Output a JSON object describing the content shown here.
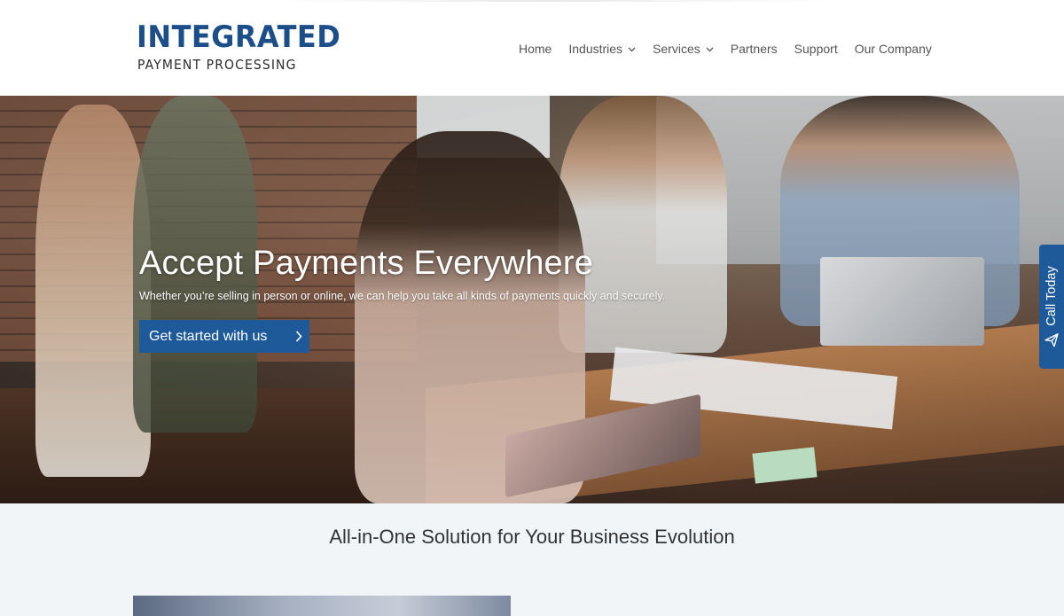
{
  "logo": {
    "main": "INTEGRATED",
    "sub": "PAYMENT PROCESSING",
    "colors": {
      "primary": "#1c4f8a",
      "sub": "#2b2b2b"
    }
  },
  "nav": {
    "items": [
      {
        "label": "Home",
        "dropdown": false
      },
      {
        "label": "Industries",
        "dropdown": true
      },
      {
        "label": "Services",
        "dropdown": true
      },
      {
        "label": "Partners",
        "dropdown": false
      },
      {
        "label": "Support",
        "dropdown": false
      },
      {
        "label": "Our Company",
        "dropdown": false
      }
    ]
  },
  "hero": {
    "title": "Accept Payments Everywhere",
    "subtitle": "Whether you’re selling in person or online, we can help you take all kinds of payments quickly and securely.",
    "cta_label": "Get started with us",
    "cta_icon": "chevron-right-icon"
  },
  "call_tab": {
    "label": "Call Today",
    "icon": "paper-plane-icon"
  },
  "section": {
    "title": "All-in-One Solution for Your Business Evolution"
  },
  "colors": {
    "accent": "#1e5a99",
    "nav_text": "#555555",
    "section_bg": "#f2f5f8"
  }
}
